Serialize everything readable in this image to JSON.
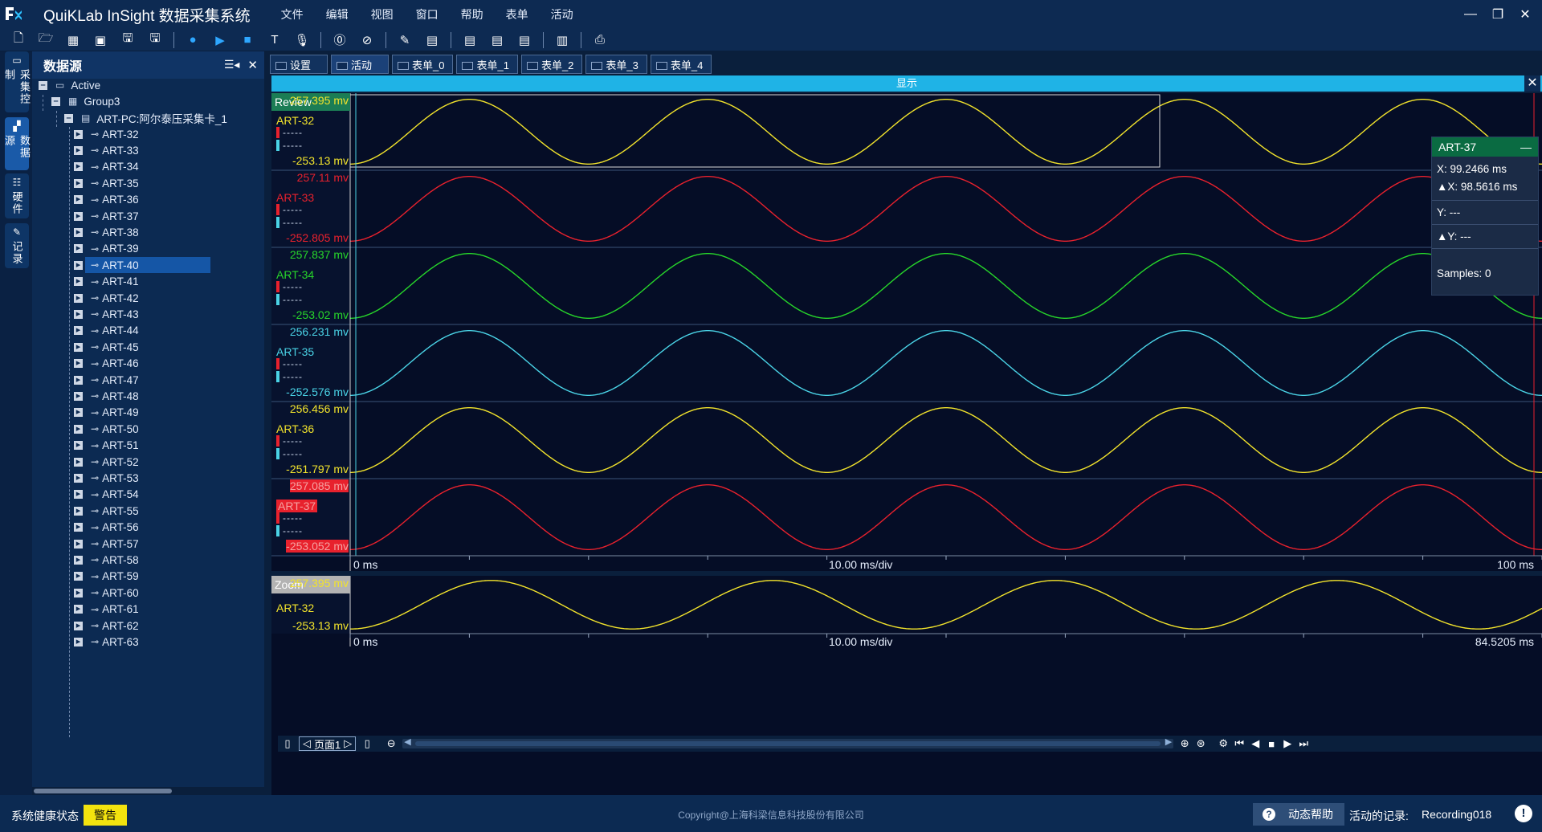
{
  "app": {
    "title": "QuiKLab InSight 数据采集系统",
    "logo_icon": "app-logo-icon"
  },
  "menu": [
    "文件",
    "编辑",
    "视图",
    "窗口",
    "帮助",
    "表单",
    "活动"
  ],
  "window_controls": {
    "minimize": "—",
    "restore": "❐",
    "close": "✕"
  },
  "toolbar_icons": [
    "new-file-icon",
    "open-folder-icon",
    "grid-icon",
    "module-icon",
    "save-icon",
    "save-as-icon",
    "sep",
    "record-icon",
    "play-icon",
    "stop-icon",
    "text-icon",
    "mic-icon",
    "sep",
    "zero-icon",
    "clear-icon",
    "sep",
    "pen-icon",
    "calendar-icon",
    "sep",
    "calendar-1-icon",
    "calendar-2-icon",
    "calendar-3-icon",
    "sep",
    "calculator-icon",
    "sep",
    "printer-icon"
  ],
  "vtabs": [
    {
      "label": "采集控制",
      "icon": "monitor-icon",
      "active": false
    },
    {
      "label": "数据源",
      "icon": "datasource-icon",
      "active": true
    },
    {
      "label": "硬件",
      "icon": "hardware-icon",
      "active": false
    },
    {
      "label": "记录",
      "icon": "record-pen-icon",
      "active": false
    }
  ],
  "datasource": {
    "title": "数据源",
    "pin_icon": "pin-icon",
    "close_icon": "close-icon",
    "tree": {
      "root": "Active",
      "group": "Group3",
      "device": "ART-PC:阿尔泰压采集卡_1",
      "channels": [
        "ART-32",
        "ART-33",
        "ART-34",
        "ART-35",
        "ART-36",
        "ART-37",
        "ART-38",
        "ART-39",
        "ART-40",
        "ART-41",
        "ART-42",
        "ART-43",
        "ART-44",
        "ART-45",
        "ART-46",
        "ART-47",
        "ART-48",
        "ART-49",
        "ART-50",
        "ART-51",
        "ART-52",
        "ART-53",
        "ART-54",
        "ART-55",
        "ART-56",
        "ART-57",
        "ART-58",
        "ART-59",
        "ART-60",
        "ART-61",
        "ART-62",
        "ART-63"
      ],
      "selected": "ART-40"
    }
  },
  "doc_tabs": [
    {
      "label": "设置",
      "active": false
    },
    {
      "label": "活动",
      "active": true
    },
    {
      "label": "表单_0",
      "active": false
    },
    {
      "label": "表单_1",
      "active": false
    },
    {
      "label": "表单_2",
      "active": false
    },
    {
      "label": "表单_3",
      "active": false
    },
    {
      "label": "表单_4",
      "active": false
    }
  ],
  "display": {
    "title": "显示",
    "close": "✕"
  },
  "review": {
    "label": "Review",
    "lanes": [
      {
        "name": "ART-32",
        "max": "257.395 mv",
        "min": "-253.13 mv",
        "color": "#f2e32c",
        "amplitude": 255.3,
        "highlight": false
      },
      {
        "name": "ART-33",
        "max": "257.11 mv",
        "min": "-252.805 mv",
        "color": "#e8212d",
        "amplitude": 255.0,
        "highlight": false
      },
      {
        "name": "ART-34",
        "max": "257.837 mv",
        "min": "-253.02 mv",
        "color": "#27d62a",
        "amplitude": 255.4,
        "highlight": false
      },
      {
        "name": "ART-35",
        "max": "256.231 mv",
        "min": "-252.576 mv",
        "color": "#4ad3e6",
        "amplitude": 254.4,
        "highlight": false
      },
      {
        "name": "ART-36",
        "max": "256.456 mv",
        "min": "-251.797 mv",
        "color": "#f2e32c",
        "amplitude": 254.1,
        "highlight": false
      },
      {
        "name": "ART-37",
        "max": "257.085 mv",
        "min": "-253.052 mv",
        "color": "#e8212d",
        "amplitude": 255.1,
        "highlight": true
      }
    ],
    "legend_dash": "-----",
    "x_start": "0 ms",
    "x_div": "10.00 ms/div",
    "x_end": "100 ms"
  },
  "zoom": {
    "label": "Zoom",
    "name": "ART-32",
    "max": "257.395 mv",
    "min": "-253.13 mv",
    "color": "#f2e32c",
    "x_start": "0 ms",
    "x_div": "10.00 ms/div",
    "x_end": "84.5205 ms"
  },
  "signal": {
    "period_ms": 20,
    "phase_ms": 5,
    "review_span_ms": 100,
    "zoom_span_ms": 84.5205
  },
  "cursor_panel": {
    "channel": "ART-37",
    "minimize": "—",
    "x": "X: 99.2466 ms",
    "dx": "▲X: 98.5616 ms",
    "y": "Y: ---",
    "dy": "▲Y: ---",
    "samples": "Samples: 0"
  },
  "controls": {
    "page_label": "页面1",
    "prev": "◁",
    "next": "▷"
  },
  "status": {
    "health_label": "系统健康状态",
    "warning": "警告",
    "copyright": "Copyright@上海科梁信息科技股份有限公司",
    "help": "动态帮助",
    "recording_label": "活动的记录:",
    "recording_value": "Recording018"
  }
}
